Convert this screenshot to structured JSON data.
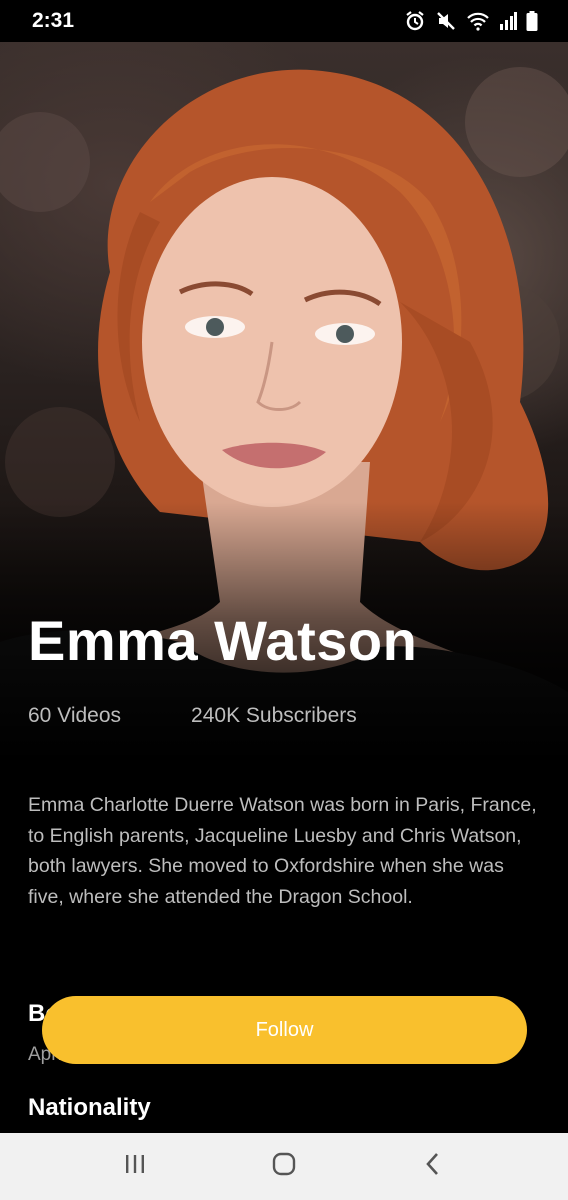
{
  "status_bar": {
    "time": "2:31",
    "icons": [
      "alarm-icon",
      "mute-icon",
      "wifi-icon",
      "signal-icon",
      "battery-icon"
    ]
  },
  "profile": {
    "name": "Emma Watson",
    "videos": "60 Videos",
    "subscribers": "240K Subscribers",
    "bio": "Emma Charlotte Duerre Watson was born in Paris, France, to English parents, Jacqueline Luesby and Chris Watson, both lawyers. She moved to Oxfordshire when she was five, where she attended the Dragon School.",
    "born_heading": "Born",
    "born_value": "April 15, 1990",
    "nationality_heading": "Nationality"
  },
  "follow": {
    "label": "Follow"
  },
  "colors": {
    "accent": "#f9c02d",
    "background": "#000000",
    "muted_text": "#bdbdbd"
  },
  "nav": {
    "icons": [
      "recent-apps-icon",
      "home-icon",
      "back-icon"
    ]
  }
}
